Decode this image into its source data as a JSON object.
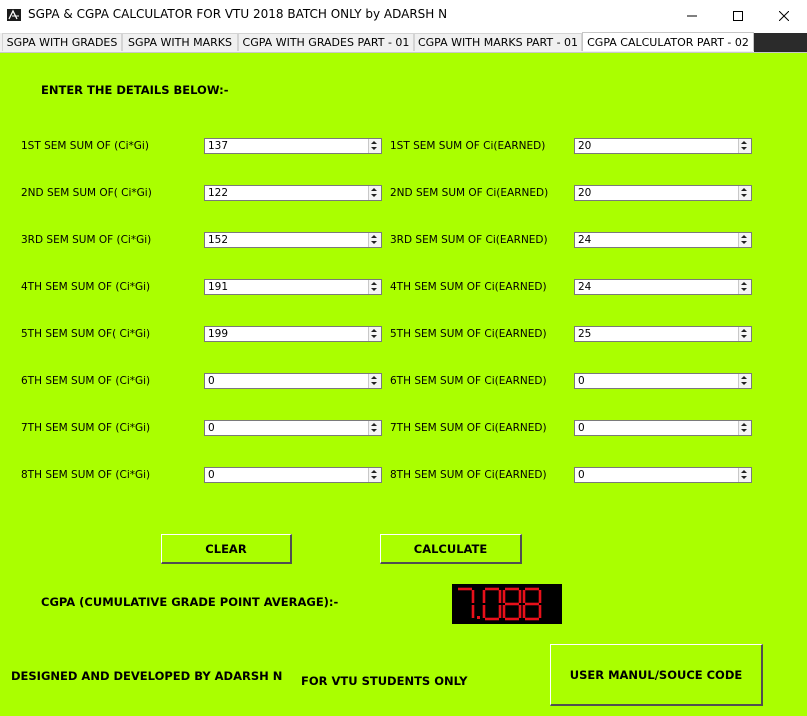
{
  "window": {
    "title": "SGPA & CGPA CALCULATOR FOR VTU 2018 BATCH ONLY by ADARSH N",
    "icon": "app-logo-icon",
    "controls": [
      "minimize-icon",
      "maximize-icon",
      "close-icon"
    ]
  },
  "tabs": [
    {
      "label": "SGPA WITH GRADES",
      "active": false
    },
    {
      "label": "SGPA WITH MARKS",
      "active": false
    },
    {
      "label": "CGPA WITH GRADES PART - 01",
      "active": false
    },
    {
      "label": "CGPA WITH MARKS PART - 01",
      "active": false
    },
    {
      "label": "CGPA CALCULATOR PART - 02",
      "active": true
    }
  ],
  "panel": {
    "background": "#aaff00",
    "heading": "ENTER THE DETAILS BELOW:-",
    "rows": [
      {
        "left_label": "1ST SEM SUM OF (Ci*Gi)",
        "left_value": "137",
        "right_label": "1ST SEM SUM OF Ci(EARNED)",
        "right_value": "20"
      },
      {
        "left_label": "2ND SEM SUM OF( Ci*Gi)",
        "left_value": "122",
        "right_label": "2ND  SEM SUM OF Ci(EARNED)",
        "right_value": "20"
      },
      {
        "left_label": "3RD SEM SUM OF (Ci*Gi)",
        "left_value": "152",
        "right_label": "3RD  SEM SUM OF Ci(EARNED)",
        "right_value": "24"
      },
      {
        "left_label": "4TH SEM SUM OF (Ci*Gi)",
        "left_value": "191",
        "right_label": "4TH  SEM SUM OF Ci(EARNED)",
        "right_value": "24"
      },
      {
        "left_label": "5TH SEM SUM OF( Ci*Gi)",
        "left_value": "199",
        "right_label": "5TH  SEM SUM OF Ci(EARNED)",
        "right_value": "25"
      },
      {
        "left_label": "6TH SEM SUM OF (Ci*Gi)",
        "left_value": "0",
        "right_label": "6TH  SEM SUM OF Ci(EARNED)",
        "right_value": "0"
      },
      {
        "left_label": "7TH SEM SUM OF (Ci*Gi)",
        "left_value": "0",
        "right_label": "7TH  SEM SUM OF Ci(EARNED)",
        "right_value": "0"
      },
      {
        "left_label": "8TH SEM SUM OF (Ci*Gi)",
        "left_value": "0",
        "right_label": "8TH  SEM SUM OF Ci(EARNED)",
        "right_value": "0"
      }
    ],
    "clear_label": "CLEAR",
    "calculate_label": "CALCULATE",
    "cgpa_label": "CGPA (CUMULATIVE GRADE POINT AVERAGE):-",
    "cgpa_value": "7.088",
    "lcd_color": "#e8101a",
    "designed_by": "DESIGNED AND DEVELOPED BY ADARSH N",
    "for_students": "FOR VTU STUDENTS ONLY",
    "manual_label": "USER MANUL/SOUCE CODE"
  }
}
